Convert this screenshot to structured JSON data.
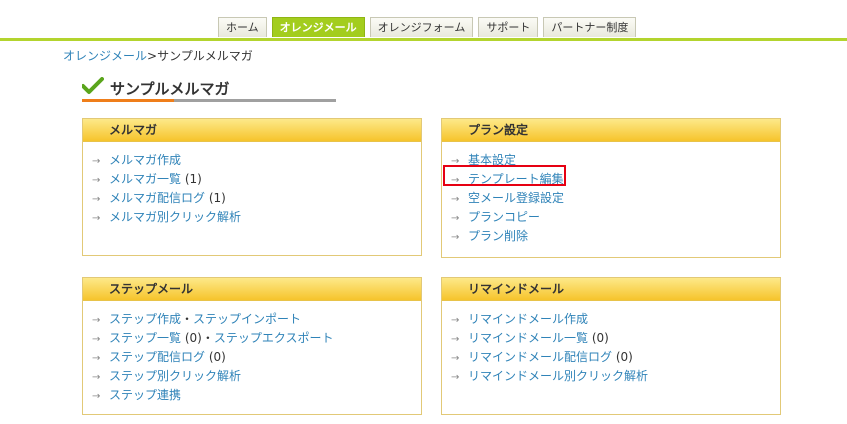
{
  "nav": {
    "tabs": [
      {
        "label": "ホーム",
        "active": false
      },
      {
        "label": "オレンジメール",
        "active": true
      },
      {
        "label": "オレンジフォーム",
        "active": false
      },
      {
        "label": "サポート",
        "active": false
      },
      {
        "label": "パートナー制度",
        "active": false
      }
    ]
  },
  "breadcrumb": {
    "parent": "オレンジメール",
    "separator": ">",
    "current": "サンプルメルマガ"
  },
  "page": {
    "title": "サンプルメルマガ",
    "icon": "check-icon",
    "accent_color": "#ef7e1a"
  },
  "panels": {
    "mailmag": {
      "title": "メルマガ",
      "items": [
        {
          "label": "メルマガ作成",
          "count": ""
        },
        {
          "label": "メルマガ一覧",
          "count": "(1)"
        },
        {
          "label": "メルマガ配信ログ",
          "count": "(1)"
        },
        {
          "label": "メルマガ別クリック解析",
          "count": ""
        }
      ]
    },
    "plan": {
      "title": "プラン設定",
      "items": [
        {
          "label": "基本設定"
        },
        {
          "label": "テンプレート編集"
        },
        {
          "label": "空メール登録設定"
        },
        {
          "label": "プランコピー"
        },
        {
          "label": "プラン削除"
        }
      ]
    },
    "step": {
      "title": "ステップメール",
      "items": [
        {
          "label": "ステップ作成",
          "sep": "・",
          "label2": "ステップインポート",
          "count": ""
        },
        {
          "label": "ステップ一覧",
          "count": "(0)",
          "sep": "・",
          "label2": "ステップエクスポート"
        },
        {
          "label": "ステップ配信ログ",
          "count": "(0)"
        },
        {
          "label": "ステップ別クリック解析"
        },
        {
          "label": "ステップ連携"
        }
      ]
    },
    "remind": {
      "title": "リマインドメール",
      "items": [
        {
          "label": "リマインドメール作成",
          "count": ""
        },
        {
          "label": "リマインドメール一覧",
          "count": "(0)"
        },
        {
          "label": "リマインドメール配信ログ",
          "count": "(0)"
        },
        {
          "label": "リマインドメール別クリック解析",
          "count": ""
        }
      ]
    }
  },
  "arrow_glyph": "→",
  "colors": {
    "nav_active": "#a3cd1d",
    "link": "#2f83b8",
    "panel_header": "#f6c42c",
    "highlight": "#e60012"
  }
}
